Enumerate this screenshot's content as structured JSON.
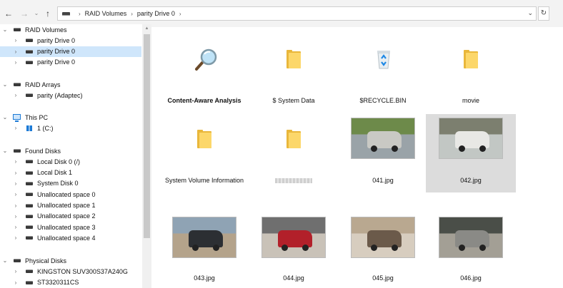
{
  "address_bar": {
    "segments": [
      "RAID Volumes",
      "parity Drive 0"
    ]
  },
  "sidebar": {
    "groups": [
      {
        "label": "RAID Volumes",
        "items": [
          "parity Drive 0",
          "parity Drive 0",
          "parity Drive 0"
        ],
        "selected_index": 1
      },
      {
        "label": "RAID Arrays",
        "items": [
          "parity (Adaptec)"
        ]
      },
      {
        "label": "This PC",
        "items": [
          "1 (C:)"
        ]
      },
      {
        "label": "Found Disks",
        "items": [
          "Local Disk 0 (/)",
          "Local Disk 1",
          "System Disk 0",
          "Unallocated space 0",
          "Unallocated space 1",
          "Unallocated space 2",
          "Unallocated space 3",
          "Unallocated space 4"
        ]
      },
      {
        "label": "Physical Disks",
        "items": [
          "KINGSTON SUV300S37A240G",
          "ST3320311CS"
        ]
      }
    ]
  },
  "content": {
    "tiles": [
      {
        "label": "Content-Aware Analysis",
        "icon": "magnifier-icon"
      },
      {
        "label": "$ System Data",
        "icon": "folder-icon"
      },
      {
        "label": "$RECYCLE.BIN",
        "icon": "recycle-bin-icon"
      },
      {
        "label": "movie",
        "icon": "folder-icon"
      },
      {
        "label": "System Volume Information",
        "icon": "folder-icon"
      },
      {
        "label": "",
        "icon": "folder-icon"
      },
      {
        "label": "041.jpg",
        "icon": "photo-thumbnail"
      },
      {
        "label": "042.jpg",
        "icon": "photo-thumbnail"
      },
      {
        "label": "043.jpg",
        "icon": "photo-thumbnail"
      },
      {
        "label": "044.jpg",
        "icon": "photo-thumbnail"
      },
      {
        "label": "045.jpg",
        "icon": "photo-thumbnail"
      },
      {
        "label": "046.jpg",
        "icon": "photo-thumbnail"
      }
    ],
    "hovered_index": 7
  },
  "colors": {
    "selection": "#cfe6fb",
    "hover_tile": "#dcdcdc",
    "folder": "#fcd76a"
  }
}
